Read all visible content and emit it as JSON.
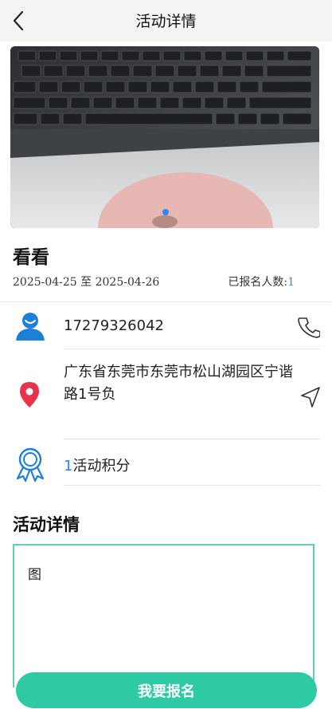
{
  "header": {
    "title": "活动详情",
    "back_icon": "back-arrow-icon"
  },
  "banner": {
    "carousel_dots": 1
  },
  "activity": {
    "title": "看看",
    "date_range": "2025-04-25 至 2025-04-26",
    "signed_up_label": "已报名人数:",
    "signed_up_count": "1"
  },
  "contact": {
    "phone": "17279326042",
    "icon": "user-icon",
    "action_icon": "phone-icon"
  },
  "location": {
    "address": "广东省东莞市东莞市松山湖园区宁谐路1号负",
    "icon": "location-pin-icon",
    "action_icon": "navigate-icon"
  },
  "points": {
    "value": "1",
    "label": "活动积分",
    "icon": "award-ribbon-icon"
  },
  "details": {
    "title": "活动详情",
    "content": "图"
  },
  "footer": {
    "signup_label": "我要报名"
  },
  "colors": {
    "accent": "#2ecaa4",
    "blue": "#2f86f6",
    "pin": "#e8344a"
  }
}
